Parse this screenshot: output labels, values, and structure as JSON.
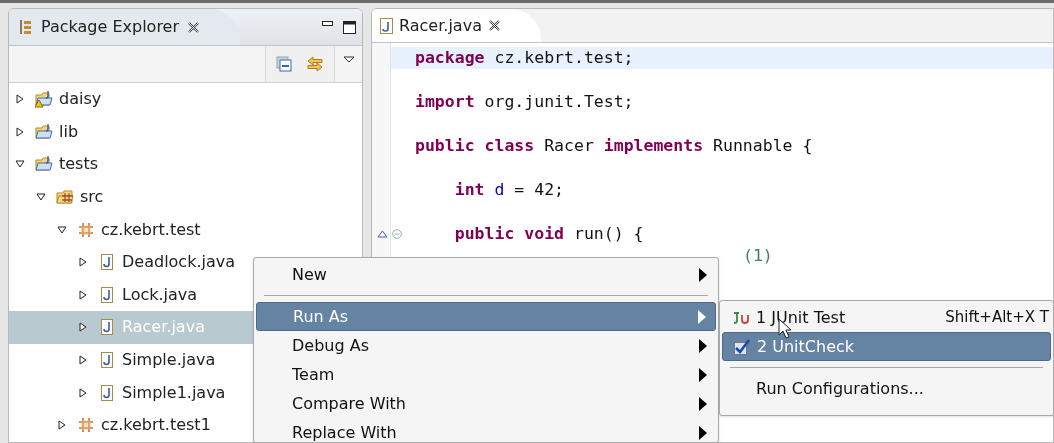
{
  "explorer": {
    "title": "Package Explorer",
    "tree": [
      {
        "label": "daisy",
        "kind": "project_warning",
        "expanded": false,
        "selected": false
      },
      {
        "label": "lib",
        "kind": "project",
        "expanded": false,
        "selected": false
      },
      {
        "label": "tests",
        "kind": "project",
        "expanded": true,
        "selected": false,
        "children": [
          {
            "label": "src",
            "kind": "source_folder",
            "expanded": true,
            "selected": false,
            "children": [
              {
                "label": "cz.kebrt.test",
                "kind": "package",
                "expanded": true,
                "selected": false,
                "children": [
                  {
                    "label": "Deadlock.java",
                    "kind": "java_file",
                    "expanded": false,
                    "selected": false
                  },
                  {
                    "label": "Lock.java",
                    "kind": "java_file",
                    "expanded": false,
                    "selected": false
                  },
                  {
                    "label": "Racer.java",
                    "kind": "java_file",
                    "expanded": false,
                    "selected": true
                  },
                  {
                    "label": "Simple.java",
                    "kind": "java_file",
                    "expanded": false,
                    "selected": false
                  },
                  {
                    "label": "Simple1.java",
                    "kind": "java_file",
                    "expanded": false,
                    "selected": false
                  }
                ]
              },
              {
                "label": "cz.kebrt.test1",
                "kind": "package",
                "expanded": false,
                "selected": false
              }
            ]
          }
        ]
      }
    ]
  },
  "editor": {
    "tab": {
      "title": "Racer.java",
      "selected": true
    },
    "lines": [
      {
        "current": true,
        "tokens": [
          {
            "kind": "keyword",
            "text": "package"
          },
          {
            "kind": "plain",
            "text": " cz.kebrt.test;"
          }
        ]
      },
      {
        "current": false
      },
      {
        "current": false,
        "tokens": [
          {
            "kind": "keyword",
            "text": "import"
          },
          {
            "kind": "plain",
            "text": " org.junit.Test;"
          }
        ]
      },
      {
        "current": false
      },
      {
        "current": false,
        "tokens": [
          {
            "kind": "keyword",
            "text": "public class"
          },
          {
            "kind": "plain",
            "text": " Racer "
          },
          {
            "kind": "keyword",
            "text": "implements"
          },
          {
            "kind": "plain",
            "text": " Runnable {"
          }
        ]
      },
      {
        "current": false
      },
      {
        "current": false,
        "tokens": [
          {
            "kind": "keyword",
            "text": "    int"
          },
          {
            "kind": "field",
            "text": " d"
          },
          {
            "kind": "plain",
            "text": " = 42;"
          }
        ]
      },
      {
        "current": false
      },
      {
        "current": false,
        "kind": "override",
        "tokens": [
          {
            "kind": "keyword",
            "text": "    public void"
          },
          {
            "kind": "plain",
            "text": " run() {"
          }
        ]
      },
      {
        "current": false,
        "kind": "covered",
        "tokens": [
          {
            "kind": "comment",
            "text": "(1)"
          }
        ]
      }
    ]
  },
  "context_menu": {
    "items": [
      {
        "kind": "item",
        "label": "New",
        "submenu": true,
        "selected": false
      },
      {
        "kind": "separator"
      },
      {
        "kind": "item",
        "label": "Run As",
        "submenu": true,
        "selected": true
      },
      {
        "kind": "item",
        "label": "Debug As",
        "submenu": true,
        "selected": false
      },
      {
        "kind": "item",
        "label": "Team",
        "submenu": true,
        "selected": false
      },
      {
        "kind": "item",
        "label": "Compare With",
        "submenu": true,
        "selected": false
      },
      {
        "kind": "item",
        "label": "Replace With",
        "submenu": true,
        "selected": false
      }
    ]
  },
  "submenu": {
    "items": [
      {
        "kind": "junit_item",
        "label": "1 JUnit Test",
        "shortcut": "Shift+Alt+X T",
        "selected": false
      },
      {
        "kind": "check_item",
        "label": "2 UnitCheck",
        "selected": true
      },
      {
        "kind": "separator"
      },
      {
        "kind": "item",
        "label": "Run Configurations...",
        "selected": false
      }
    ]
  }
}
